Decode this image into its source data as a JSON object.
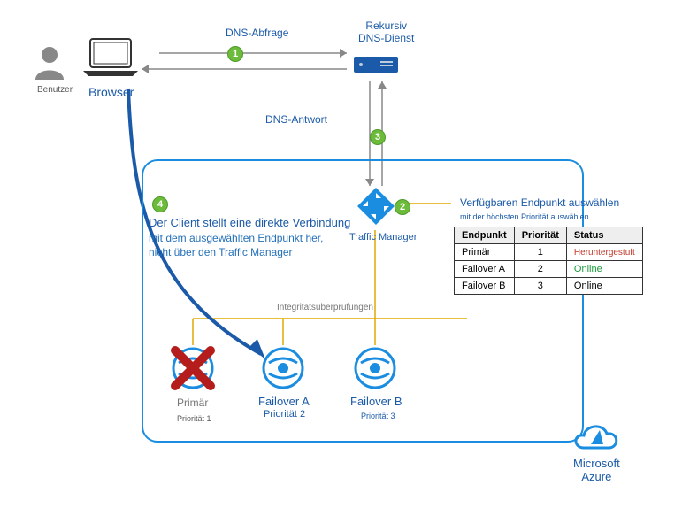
{
  "labels": {
    "user": "Benutzer",
    "browser": "Browser",
    "dns_query": "DNS-Abfrage",
    "recursive_dns": "Rekursiv\nDNS-Dienst",
    "dns_answer": "DNS-Antwort",
    "traffic_manager": "Traffic Manager",
    "health_checks": "Integritätsüberprüfungen",
    "select_endpoint": "Verfügbaren Endpunkt auswählen",
    "select_endpoint_sub": "mit der höchsten Priorität auswählen",
    "client_connects_1": "Der Client stellt eine direkte Verbindung",
    "client_connects_2": "mit dem ausgewählten Endpunkt her,",
    "client_connects_3": "nicht über den Traffic Manager",
    "azure": "Microsoft\nAzure"
  },
  "endpoints": {
    "primary": {
      "name": "Primär",
      "priority_label": "Priorität 1"
    },
    "failover_a": {
      "name": "Failover A",
      "priority_label": "Priorität 2"
    },
    "failover_b": {
      "name": "Failover B",
      "priority_label": "Priorität 3"
    }
  },
  "table": {
    "headers": {
      "endpoint": "Endpunkt",
      "priority": "Priorität",
      "status": "Status"
    },
    "rows": [
      {
        "endpoint": "Primär",
        "priority": "1",
        "status": "Heruntergestuft",
        "status_class": "status-down"
      },
      {
        "endpoint": "Failover A",
        "priority": "2",
        "status": "Online",
        "status_class": "status-online"
      },
      {
        "endpoint": "Failover B",
        "priority": "3",
        "status": "Online",
        "status_class": ""
      }
    ]
  },
  "badges": {
    "b1": "1",
    "b2": "2",
    "b3": "3",
    "b4": "4"
  },
  "colors": {
    "accent": "#1b5aa8",
    "green": "#6dbb3b",
    "yellow": "#e0a800",
    "red": "#c0392b",
    "light_blue": "#1b8de0"
  }
}
